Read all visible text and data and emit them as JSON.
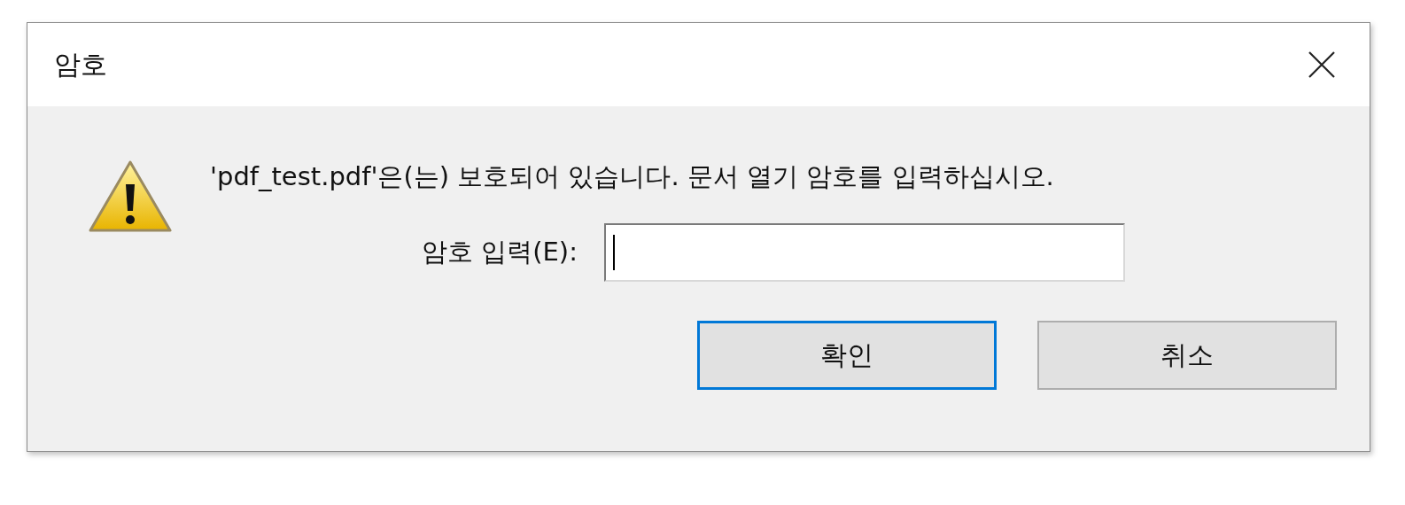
{
  "window": {
    "title": "암호"
  },
  "message": "'pdf_test.pdf'은(는) 보호되어 있습니다. 문서 열기 암호를 입력하십시오.",
  "password": {
    "label": "암호 입력(E):",
    "focused": true
  },
  "buttons": [
    {
      "label": "확인",
      "focused": true
    },
    {
      "label": "취소",
      "focused": false
    }
  ]
}
